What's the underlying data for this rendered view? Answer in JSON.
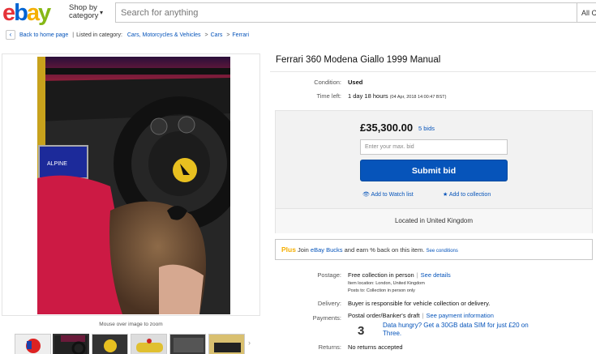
{
  "header": {
    "logo_letters": [
      "e",
      "b",
      "a",
      "y"
    ],
    "logo_colors": [
      "#e53238",
      "#0064d2",
      "#f5af02",
      "#86b817"
    ],
    "shop_by_line1": "Shop by",
    "shop_by_line2": "category",
    "chevron_icon": "chevron-down-icon",
    "search_placeholder": "Search for anything",
    "all_categories": "All C"
  },
  "breadcrumb": {
    "back_icon": "chevron-left-icon",
    "back_label": "Back to home page",
    "separator": "|",
    "listed_in": "Listed in category:",
    "items": [
      "Cars, Motorcycles & Vehicles",
      "Cars",
      "Ferrari"
    ],
    "divider": ">"
  },
  "image_panel": {
    "hint": "Mouse over image to zoom",
    "thumbnails_count": 7,
    "selected_thumbnail": 2,
    "dash_screen_text": "ALPINE"
  },
  "listing": {
    "title": "Ferrari 360 Modena Giallo 1999 Manual",
    "condition_label": "Condition:",
    "condition_value": "Used",
    "time_left_label": "Time left:",
    "time_left_value": "1 day 18 hours",
    "time_left_detail": "(04 Apr, 2018   14:00:47 BST)"
  },
  "bid": {
    "price": "£35,300.00",
    "bids": "5 bids",
    "max_bid_placeholder": "Enter your max. bid",
    "submit_label": "Submit bid",
    "watch_label": "Add to Watch list",
    "watch_icon": "eye-icon",
    "collection_label": "Add to collection",
    "collection_icon": "star-icon",
    "location": "Located in United Kingdom"
  },
  "plus": {
    "plus_label": "Plus",
    "join": "Join",
    "bucks": "eBay Bucks",
    "and_earn": "and earn % back on this item.",
    "conditions": "See conditions"
  },
  "postage": {
    "label": "Postage:",
    "value": "Free collection in person",
    "see_details": "See details",
    "item_location": "Item location:  London, United Kingdom",
    "posts_to": "Posts to:  Collection in person only"
  },
  "delivery": {
    "label": "Delivery:",
    "value": "Buyer is responsible for vehicle collection or delivery."
  },
  "payments": {
    "label": "Payments:",
    "value": "Postal order/Banker's draft",
    "see_payment": "See payment information",
    "three_icon": "three-network-logo-icon",
    "three_glyph": "3",
    "promo": "Data hungry? Get a 30GB data SIM for just £20 on Three."
  },
  "returns": {
    "label": "Returns:",
    "value": "No returns accepted"
  }
}
